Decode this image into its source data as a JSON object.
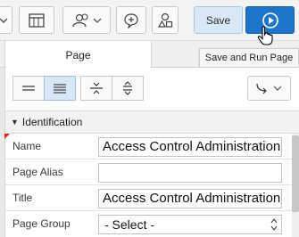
{
  "toolbar": {
    "save_label": "Save",
    "icons": [
      "chevron-down-icon",
      "shared-components-icon",
      "team-dev-icon",
      "comments-icon",
      "shapes-icon",
      "run-play-icon"
    ]
  },
  "tooltip": {
    "text": "Save and Run Page"
  },
  "tabs": {
    "active": "Page"
  },
  "section": {
    "title": "Identification"
  },
  "properties": {
    "name": {
      "label": "Name",
      "value": "Access Control Administration"
    },
    "alias": {
      "label": "Page Alias",
      "value": ""
    },
    "title": {
      "label": "Title",
      "value": "Access Control Administration"
    },
    "group": {
      "label": "Page Group",
      "value": "- Select -"
    }
  },
  "colors": {
    "accent": "#1e74c9",
    "save_bg": "#d9e8f6"
  }
}
